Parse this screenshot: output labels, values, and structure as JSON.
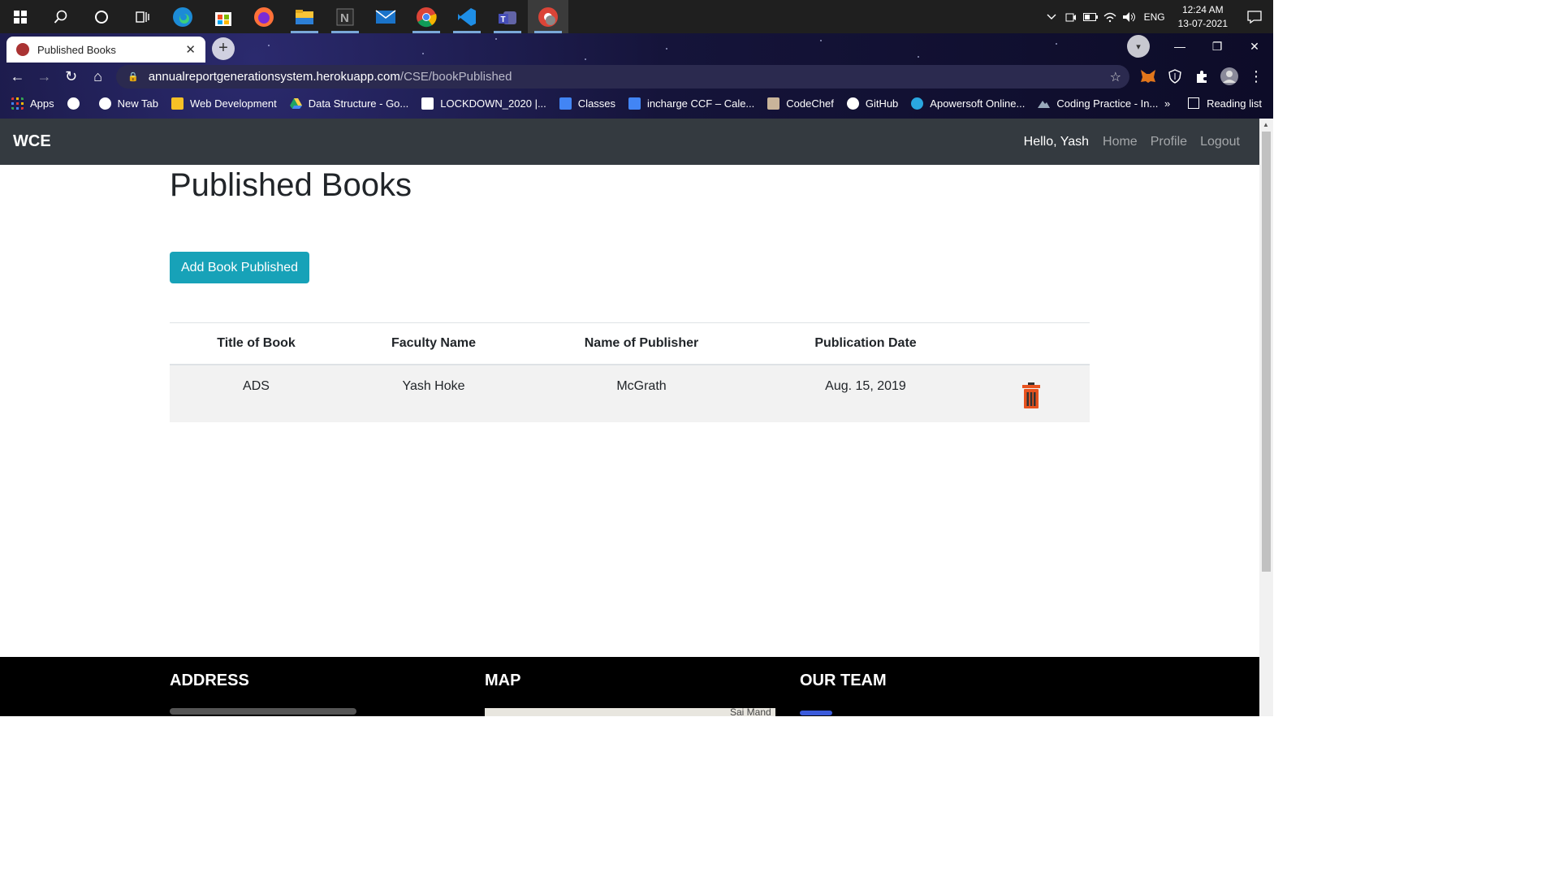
{
  "taskbar": {
    "apps": [
      "windows-start",
      "search",
      "cortana",
      "task-view",
      "edge",
      "store",
      "firefox",
      "file-explorer",
      "notion",
      "mail",
      "chrome",
      "vscode",
      "teams",
      "chrome-profile"
    ],
    "tray": {
      "lang": "ENG",
      "time": "12:24 AM",
      "date": "13-07-2021"
    }
  },
  "browser": {
    "tab_title": "Published Books",
    "url_host": "annualreportgenerationsystem.herokuapp.com",
    "url_path": "/CSE/bookPublished",
    "bookmarks": [
      {
        "label": "Apps",
        "color": "#e53935"
      },
      {
        "label": "",
        "color": "#ffffff"
      },
      {
        "label": "New Tab",
        "color": "#ffffff"
      },
      {
        "label": "Web Development",
        "color": "#f6c026"
      },
      {
        "label": "Data Structure - Go...",
        "color": "#1fa463"
      },
      {
        "label": "LOCKDOWN_2020 |...",
        "color": "#ffffff"
      },
      {
        "label": "Classes",
        "color": "#4285f4"
      },
      {
        "label": "incharge CCF – Cale...",
        "color": "#4285f4"
      },
      {
        "label": "CodeChef",
        "color": "#c9b49a"
      },
      {
        "label": "GitHub",
        "color": "#ffffff"
      },
      {
        "label": "Apowersoft Online...",
        "color": "#2aa7e0"
      },
      {
        "label": "Coding Practice - In...",
        "color": "#9ab"
      }
    ],
    "more": "»",
    "reading_list": "Reading list"
  },
  "navbar": {
    "brand": "WCE",
    "greeting": "Hello, Yash",
    "links": [
      "Home",
      "Profile",
      "Logout"
    ]
  },
  "main": {
    "title": "Published Books",
    "add_button": "Add Book Published",
    "table": {
      "headers": [
        "Title of Book",
        "Faculty Name",
        "Name of Publisher",
        "Publication Date"
      ],
      "rows": [
        [
          "ADS",
          "Yash Hoke",
          "McGrath",
          "Aug. 15, 2019"
        ]
      ]
    }
  },
  "footer": {
    "address_title": "ADDRESS",
    "map_title": "MAP",
    "team_title": "OUR TEAM",
    "map_label": "Sai Mand"
  },
  "colors": {
    "navbar": "#343a40",
    "button": "#17a2b8",
    "trash": "#e8531f"
  }
}
